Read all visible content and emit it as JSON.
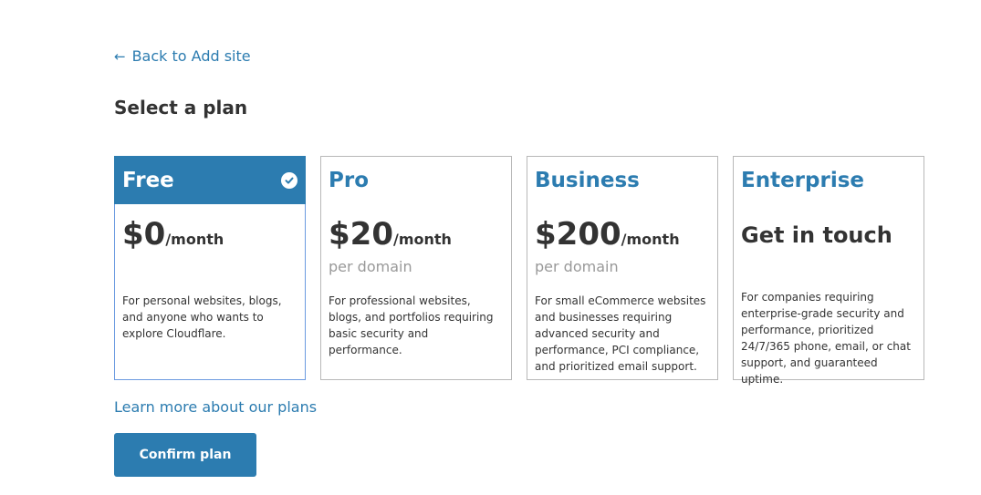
{
  "back_link": {
    "arrow": "←",
    "label": "Back to Add site"
  },
  "page_title": "Select a plan",
  "plans": [
    {
      "name": "Free",
      "price": "$0",
      "period": "/month",
      "description": "For personal websites, blogs, and anyone who wants to explore Cloudflare.",
      "selected": true
    },
    {
      "name": "Pro",
      "price": "$20",
      "period": "/month",
      "per_unit": "per domain",
      "description": "For professional websites, blogs, and portfolios requiring basic security and performance.",
      "selected": false
    },
    {
      "name": "Business",
      "price": "$200",
      "period": "/month",
      "per_unit": "per domain",
      "description": "For small eCommerce websites and businesses requiring advanced security and performance, PCI compliance, and prioritized email support.",
      "selected": false
    },
    {
      "name": "Enterprise",
      "contact_label": "Get in touch",
      "description": "For companies requiring enterprise-grade security and performance, prioritized 24/7/365 phone, email, or chat support, and guaranteed uptime.",
      "selected": false
    }
  ],
  "learn_more": "Learn more about our plans",
  "confirm_button": "Confirm plan",
  "icons": {
    "selected": "check-circle-icon",
    "back": "arrow-left-icon"
  },
  "colors": {
    "accent": "#2c7cb0",
    "selected_border": "#6b9ae0",
    "card_border": "#b8b8b8",
    "muted_text": "#999999",
    "text": "#333333"
  }
}
